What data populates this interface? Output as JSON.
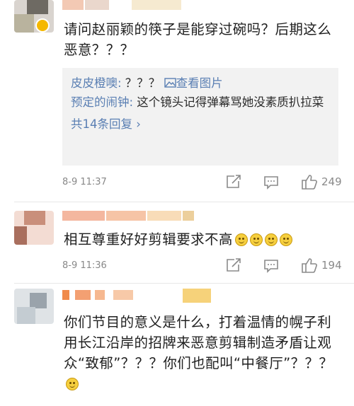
{
  "comments": [
    {
      "text": "请问赵丽颖的筷子是能穿过碗吗？后期这么恶意？？？",
      "replies": [
        {
          "user": "皮皮橙噢:",
          "text": " ？？？ ",
          "link": "查看图片"
        },
        {
          "user": "预定的闹钟:",
          "text": " 这个镜头记得弹幕骂她没素质扒拉菜"
        }
      ],
      "more_label": "共14条回复 ›",
      "time": "8-9 11:37",
      "likes": "249"
    },
    {
      "text": "相互尊重好好剪辑要求不高",
      "time": "8-9 11:36",
      "likes": "194"
    },
    {
      "text": "你们节目的意义是什么，打着温情的幌子利用长江沿岸的招牌来恶意剪辑制造矛盾让观众“致郁”？？？你们也配叫“中餐厅”？？？"
    }
  ],
  "icons": {
    "share": "share-icon",
    "comment": "comment-icon",
    "like": "thumbs-up-icon",
    "verified": "verified-badge-icon"
  },
  "colors": {
    "link": "#5a7fb3",
    "reply_bg": "#f2f2f2",
    "meta": "#888888"
  }
}
